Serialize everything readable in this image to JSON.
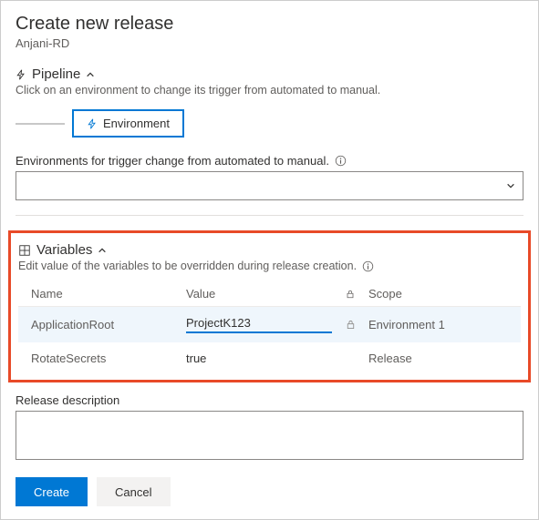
{
  "header": {
    "title": "Create new release",
    "subtitle": "Anjani-RD"
  },
  "pipeline": {
    "title": "Pipeline",
    "description": "Click on an environment to change its trigger from automated to manual.",
    "environment_node": "Environment"
  },
  "env_trigger": {
    "label": "Environments for trigger change from automated to manual.",
    "selected": ""
  },
  "variables": {
    "title": "Variables",
    "description": "Edit value of the variables to be overridden during release creation.",
    "columns": {
      "name": "Name",
      "value": "Value",
      "scope": "Scope"
    },
    "rows": [
      {
        "name": "ApplicationRoot",
        "value": "ProjectK123",
        "scope": "Environment 1",
        "selected": true
      },
      {
        "name": "RotateSecrets",
        "value": "true",
        "scope": "Release",
        "selected": false
      }
    ]
  },
  "description": {
    "label": "Release description",
    "value": ""
  },
  "actions": {
    "create": "Create",
    "cancel": "Cancel"
  }
}
